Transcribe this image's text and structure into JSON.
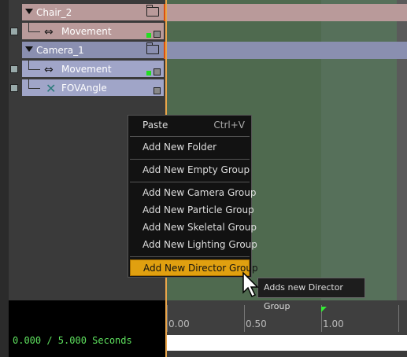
{
  "tracks": {
    "chair_group": {
      "label": "Chair_2",
      "icon": "folder-icon"
    },
    "chair_movement": {
      "label": "Movement",
      "icon": "move-arrows-icon"
    },
    "camera_group": {
      "label": "Camera_1",
      "icon": "folder-icon"
    },
    "camera_movement": {
      "label": "Movement",
      "icon": "move-arrows-icon"
    },
    "camera_fov": {
      "label": "FOVAngle",
      "icon": "fov-cross-icon"
    }
  },
  "context_menu": {
    "paste": {
      "label": "Paste",
      "shortcut": "Ctrl+V"
    },
    "items": [
      "Add New Folder",
      "Add New Empty Group",
      "Add New Camera Group",
      "Add New Particle Group",
      "Add New Skeletal Group",
      "Add New Lighting Group",
      "Add New Director Group"
    ],
    "highlighted": "Add New Director Group"
  },
  "tooltip": {
    "text": "Adds new Director Group"
  },
  "time": {
    "readout": "0.000 / 5.000 Seconds"
  },
  "ruler": {
    "labels": [
      "0.00",
      "0.50",
      "1.00"
    ]
  },
  "colors": {
    "chair_group_bg": "#b99a9a",
    "camera_group_bg": "#8a8fb0",
    "highlight": "#e0a010",
    "time_text": "#5ee05e"
  }
}
